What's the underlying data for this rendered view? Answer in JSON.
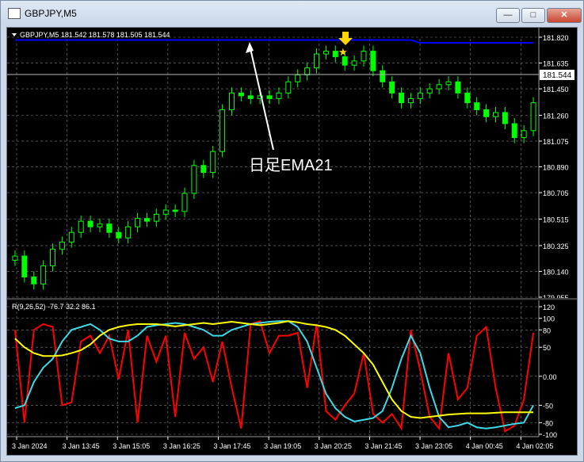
{
  "window": {
    "title": "GBPJPY,M5",
    "minimize_label": "—",
    "maximize_label": "□",
    "close_label": "✕"
  },
  "price_panel": {
    "header": "GBPJPY,M5  181.542 181.578 181.505 181.544",
    "current_price": "181.544",
    "annotation": "日足EMA21"
  },
  "indicator_panel": {
    "header": "R(9,26,52) -76.7 32.2 86.1"
  },
  "colors": {
    "background": "#000000",
    "bull_candle": "#00ff00",
    "ema": "#0000ff",
    "arrow": "#ffffff",
    "signal": "#ffd700",
    "line_red": "#ff0000",
    "line_cyan": "#3dd9e6",
    "line_yellow": "#ffff00",
    "grid": "#808080",
    "text": "#ffffff"
  },
  "chart_data": [
    {
      "type": "candlestick",
      "symbol": "GBPJPY",
      "timeframe": "M5",
      "ylim": [
        179.955,
        181.82
      ],
      "y_ticks": [
        "181.820",
        "181.635",
        "181.450",
        "181.260",
        "181.075",
        "180.890",
        "180.705",
        "180.515",
        "180.325",
        "180.140",
        "179.955"
      ],
      "x_ticks": [
        "3 Jan 2024",
        "3 Jan 13:45",
        "3 Jan 15:05",
        "3 Jan 16:25",
        "3 Jan 17:45",
        "3 Jan 19:05",
        "3 Jan 20:25",
        "3 Jan 21:45",
        "3 Jan 23:05",
        "4 Jan 00:45",
        "4 Jan 02:05"
      ],
      "close": [
        180.25,
        180.1,
        180.05,
        180.18,
        180.3,
        180.35,
        180.42,
        180.5,
        180.46,
        180.48,
        180.42,
        180.38,
        180.46,
        180.52,
        180.5,
        180.55,
        180.58,
        180.57,
        180.7,
        180.9,
        180.85,
        181.0,
        181.3,
        181.42,
        181.4,
        181.38,
        181.4,
        181.38,
        181.42,
        181.5,
        181.55,
        181.6,
        181.7,
        181.72,
        181.68,
        181.62,
        181.65,
        181.72,
        181.58,
        181.5,
        181.42,
        181.35,
        181.38,
        181.42,
        181.45,
        181.48,
        181.5,
        181.42,
        181.35,
        181.3,
        181.25,
        181.28,
        181.2,
        181.1,
        181.15,
        181.35
      ],
      "ema_daily_21": [
        181.8,
        181.8,
        181.8,
        181.8,
        181.8,
        181.8,
        181.8,
        181.8,
        181.8,
        181.8,
        181.8,
        181.8,
        181.8,
        181.8,
        181.8,
        181.8,
        181.8,
        181.8,
        181.8,
        181.8,
        181.8,
        181.8,
        181.8,
        181.8,
        181.8,
        181.8,
        181.8,
        181.8,
        181.8,
        181.8,
        181.8,
        181.8,
        181.8,
        181.8,
        181.8,
        181.8,
        181.8,
        181.8,
        181.8,
        181.8,
        181.8,
        181.8,
        181.8,
        181.78,
        181.78,
        181.78,
        181.78,
        181.78,
        181.78,
        181.78,
        181.78,
        181.78,
        181.78,
        181.78,
        181.78,
        181.78
      ]
    },
    {
      "type": "line",
      "ylim": [
        -100,
        120
      ],
      "y_ticks": [
        "120",
        "100",
        "80",
        "50",
        "0.00",
        "-50",
        "-80",
        "-100"
      ],
      "series": [
        {
          "color": "#ff0000",
          "values": [
            80,
            -80,
            80,
            90,
            85,
            -50,
            -45,
            60,
            70,
            40,
            70,
            -5,
            80,
            -80,
            70,
            25,
            70,
            -70,
            75,
            30,
            50,
            -10,
            60,
            -20,
            -90,
            90,
            95,
            40,
            70,
            70,
            75,
            -20,
            90,
            -60,
            -75,
            -50,
            -30,
            40,
            -65,
            -80,
            -65,
            -90,
            80,
            10,
            -70,
            -90,
            40,
            -40,
            -20,
            70,
            85,
            -20,
            -95,
            -85,
            -40,
            75
          ]
        },
        {
          "color": "#3dd9e6",
          "values": [
            -55,
            -50,
            -10,
            15,
            30,
            60,
            80,
            85,
            90,
            80,
            65,
            60,
            60,
            70,
            85,
            88,
            90,
            92,
            90,
            85,
            80,
            70,
            70,
            80,
            85,
            90,
            92,
            94,
            95,
            95,
            85,
            60,
            15,
            -30,
            -55,
            -70,
            -78,
            -75,
            -72,
            -60,
            -20,
            30,
            70,
            40,
            -20,
            -70,
            -88,
            -85,
            -80,
            -88,
            -90,
            -88,
            -85,
            -82,
            -80,
            -50
          ]
        },
        {
          "color": "#ffff00",
          "values": [
            65,
            50,
            40,
            35,
            35,
            36,
            40,
            45,
            55,
            70,
            80,
            85,
            88,
            90,
            90,
            90,
            88,
            86,
            88,
            90,
            92,
            90,
            92,
            94,
            92,
            90,
            88,
            90,
            92,
            95,
            93,
            90,
            88,
            85,
            80,
            70,
            55,
            40,
            20,
            -10,
            -40,
            -60,
            -70,
            -72,
            -70,
            -68,
            -66,
            -65,
            -64,
            -64,
            -64,
            -63,
            -62,
            -62,
            -62,
            -62
          ]
        }
      ]
    }
  ]
}
